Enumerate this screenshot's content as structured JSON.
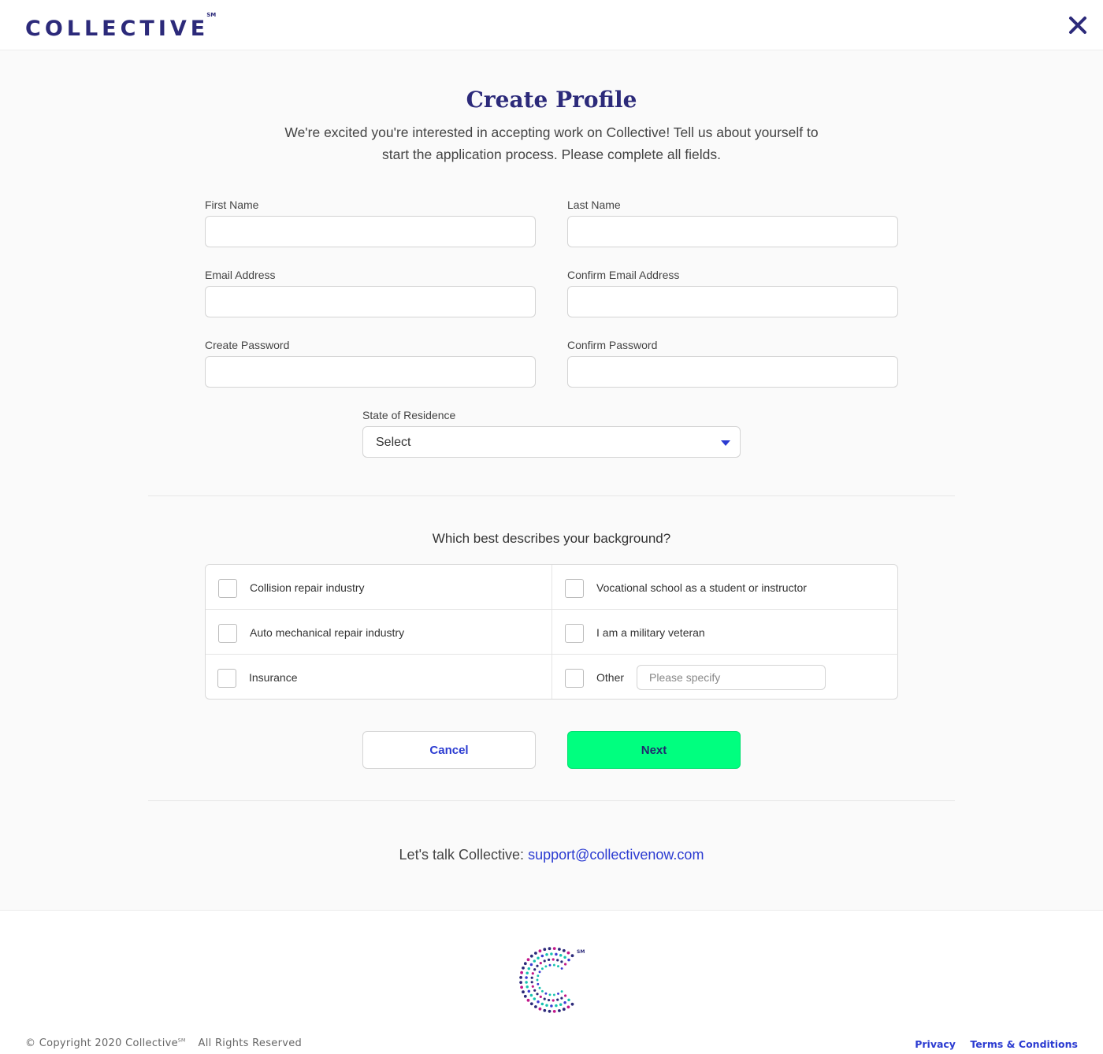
{
  "header": {
    "logo_text": "COLLECTIVE",
    "logo_mark": "SM",
    "close_icon": "close-icon"
  },
  "page": {
    "title": "Create Profile",
    "intro": "We're excited you're interested in accepting work on Collective! Tell us about yourself to start the application process. Please complete all fields."
  },
  "form": {
    "first_name_label": "First Name",
    "first_name_value": "",
    "last_name_label": "Last Name",
    "last_name_value": "",
    "email_label": "Email Address",
    "email_value": "",
    "confirm_email_label": "Confirm Email Address",
    "confirm_email_value": "",
    "password_label": "Create Password",
    "confirm_password_label": "Confirm Password",
    "state_label": "State of Residence",
    "state_value": "Select"
  },
  "background": {
    "question": "Which best describes your background?",
    "options": [
      {
        "label": "Collision repair industry",
        "checked": false
      },
      {
        "label": "Vocational school as a student or instructor",
        "checked": false
      },
      {
        "label": "Auto mechanical repair industry",
        "checked": false
      },
      {
        "label": "I am a military veteran",
        "checked": false
      },
      {
        "label": "Insurance",
        "checked": false
      },
      {
        "label": "Other",
        "checked": false
      }
    ],
    "other_placeholder": "Please specify"
  },
  "actions": {
    "cancel_label": "Cancel",
    "next_label": "Next"
  },
  "contact": {
    "prefix": "Let's talk Collective: ",
    "email": "support@collectivenow.com"
  },
  "footer": {
    "copyright": "© Copyright 2020 Collective",
    "copyright_mark": "SM",
    "rights": "All Rights Reserved",
    "logo_mark": "SM",
    "privacy_label": "Privacy",
    "terms_label": "Terms & Conditions"
  },
  "colors": {
    "brand": "#2c2a7a",
    "accent": "#2b3bd1",
    "next_button": "#00ff7f"
  }
}
